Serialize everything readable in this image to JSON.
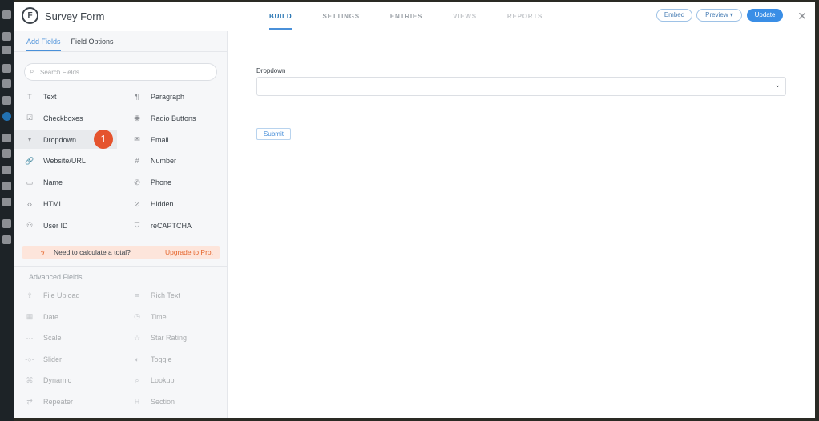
{
  "header": {
    "title": "Survey Form",
    "tabs": [
      "BUILD",
      "SETTINGS",
      "ENTRIES",
      "VIEWS",
      "REPORTS"
    ],
    "embed": "Embed",
    "preview": "Preview ▾",
    "update": "Update",
    "close": "✕"
  },
  "sidebar": {
    "tabs": [
      "Add Fields",
      "Field Options"
    ],
    "search_placeholder": "Search Fields",
    "fields": [
      [
        "Text",
        "Paragraph"
      ],
      [
        "Checkboxes",
        "Radio Buttons"
      ],
      [
        "Dropdown",
        "Email"
      ],
      [
        "Website/URL",
        "Number"
      ],
      [
        "Name",
        "Phone"
      ],
      [
        "HTML",
        "Hidden"
      ],
      [
        "User ID",
        "reCAPTCHA"
      ]
    ],
    "badge": "1",
    "promo": {
      "text": "Need to calculate a total?",
      "link": "Upgrade to Pro."
    },
    "advanced_heading": "Advanced Fields",
    "advanced": [
      [
        "File Upload",
        "Rich Text"
      ],
      [
        "Date",
        "Time"
      ],
      [
        "Scale",
        "Star Rating"
      ],
      [
        "Slider",
        "Toggle"
      ],
      [
        "Dynamic",
        "Lookup"
      ],
      [
        "Repeater",
        "Section"
      ]
    ]
  },
  "form": {
    "dropdown_label": "Dropdown",
    "submit": "Submit"
  }
}
